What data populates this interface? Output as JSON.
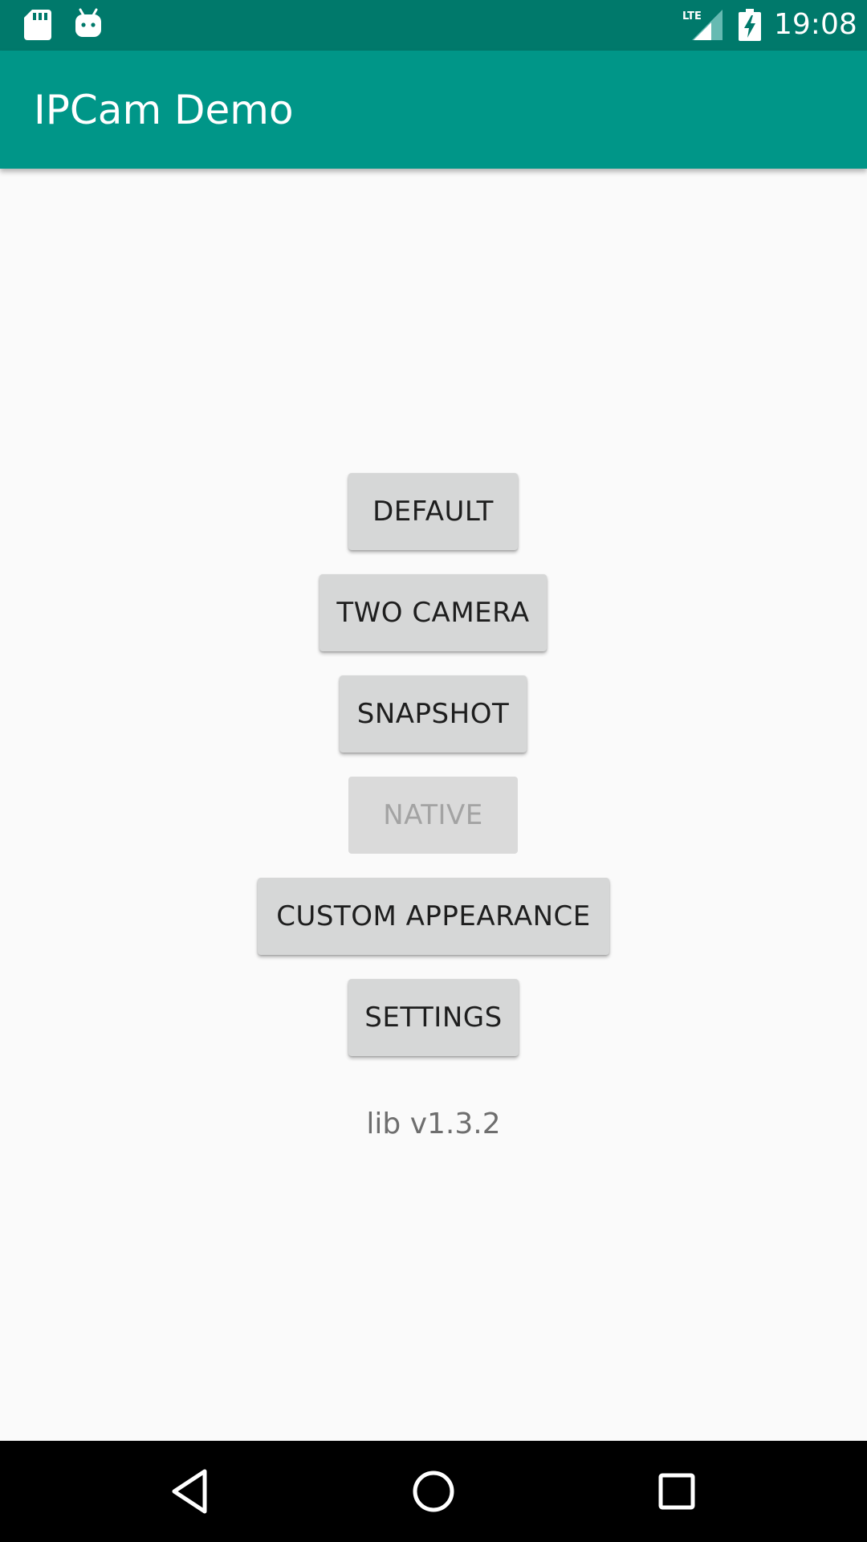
{
  "status_bar": {
    "time": "19:08",
    "network_label": "LTE",
    "icons": [
      "sd-card-icon",
      "android-icon",
      "lte-signal-icon",
      "battery-charging-icon"
    ]
  },
  "app_bar": {
    "title": "IPCam Demo"
  },
  "buttons": {
    "default": "DEFAULT",
    "two_camera": "TWO CAMERA",
    "snapshot": "SNAPSHOT",
    "native": "NATIVE",
    "custom_appearance": "CUSTOM APPEARANCE",
    "settings": "SETTINGS"
  },
  "buttons_state": {
    "native_enabled": false
  },
  "version": "lib v1.3.2",
  "nav_bar": {
    "icons": [
      "back-icon",
      "home-icon",
      "recents-icon"
    ]
  },
  "colors": {
    "status_bar": "#00796b",
    "app_bar": "#009688",
    "background": "#fafafa",
    "button": "#d6d7d7"
  }
}
